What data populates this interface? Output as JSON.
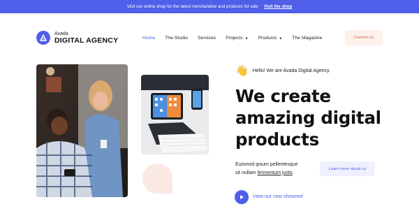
{
  "announcement": {
    "text": "Visit our online shop for the latest merchandise and products for sale",
    "link": "Visit the shop"
  },
  "logo": {
    "small": "Avada",
    "big": "DIGITAL AGENCY"
  },
  "nav": {
    "items": [
      {
        "label": "Home"
      },
      {
        "label": "The Studio"
      },
      {
        "label": "Services"
      },
      {
        "label": "Projects"
      },
      {
        "label": "Products"
      },
      {
        "label": "The Magazine"
      }
    ]
  },
  "contact_label": "Contact Us",
  "hero": {
    "greeting": "Hello! We are Avada Digital Agency.",
    "headline": [
      "We create",
      "amazing digital",
      "products"
    ],
    "sub_line1": "Euismod ipsum pellentesque",
    "sub_line2_prefix": "sit nullam ",
    "sub_line2_link": "fermentum justo",
    "sub_line2_suffix": ".",
    "learn_label": "Learn more about us",
    "showreel_label": "View our new showreel"
  },
  "colors": {
    "accent": "#4f5fe9",
    "contact_bg": "#fdf1ec",
    "contact_text": "#d36b4d",
    "learn_bg": "#eef1fd",
    "blob": "#fbe9e4"
  },
  "icons": {
    "logo": "avada-logo-icon",
    "wave": "waving-hand-icon",
    "play": "play-icon",
    "chevron": "chevron-down-icon"
  }
}
